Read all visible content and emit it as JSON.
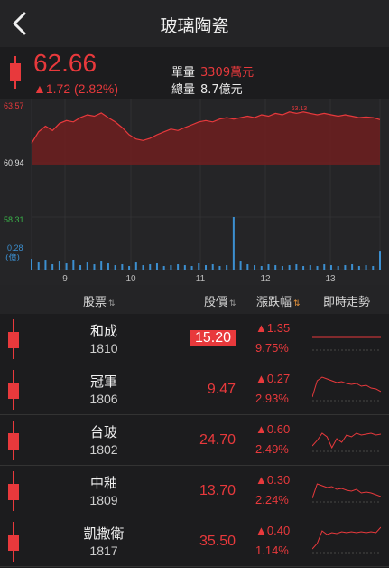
{
  "header": {
    "title": "玻璃陶瓷"
  },
  "quote": {
    "price": "62.66",
    "change": "▲1.72 (2.82%)",
    "single_volume_label": "單量",
    "single_volume_value": "3309萬元",
    "total_volume_label": "總量",
    "total_volume_value": "8.7億元"
  },
  "colors": {
    "up": "#e8393c",
    "down": "#3ab54a",
    "volume": "#3c8fd0",
    "background": "#1c1c1e",
    "sort_active": "#e8943c"
  },
  "chart_data": {
    "type": "area",
    "price_axis": {
      "high_label": "63.57",
      "open_label": "60.94",
      "peak_annotation": "63.13",
      "ylim": [
        59.5,
        63.57
      ]
    },
    "volume_axis": {
      "max_label": "58.31",
      "min_label": "0.28",
      "unit_label": "(億)"
    },
    "x_labels": [
      "9",
      "10",
      "11",
      "12",
      "13"
    ],
    "price_series": [
      61.0,
      61.8,
      62.2,
      61.9,
      62.4,
      62.6,
      62.5,
      62.8,
      63.0,
      62.9,
      63.13,
      62.8,
      62.5,
      62.1,
      61.6,
      61.3,
      61.2,
      61.35,
      61.6,
      61.8,
      62.0,
      61.9,
      62.1,
      62.3,
      62.5,
      62.6,
      62.5,
      62.7,
      62.8,
      62.7,
      62.8,
      62.9,
      62.8,
      63.0,
      62.9,
      63.1,
      63.0,
      63.2,
      63.1,
      63.2,
      63.1,
      63.0,
      63.1,
      63.0,
      62.9,
      63.0,
      62.9,
      62.8,
      62.85,
      62.8,
      62.66
    ],
    "volume_series": [
      12,
      8,
      10,
      6,
      9,
      7,
      11,
      5,
      8,
      6,
      9,
      7,
      5,
      6,
      4,
      8,
      5,
      6,
      7,
      4,
      5,
      6,
      5,
      4,
      7,
      5,
      6,
      4,
      5,
      58.31,
      9,
      6,
      5,
      4,
      6,
      5,
      4,
      5,
      6,
      4,
      5,
      4,
      6,
      5,
      4,
      5,
      6,
      4,
      5,
      4,
      20
    ]
  },
  "table": {
    "headers": {
      "stock": "股票",
      "price": "股價",
      "change": "漲跌幅",
      "trend": "即時走勢"
    },
    "sort_icon": "⇅",
    "rows": [
      {
        "name": "和成",
        "code": "1810",
        "price": "15.20",
        "change": "▲1.35",
        "pct": "9.75%",
        "highlight": true,
        "spark": [
          20,
          20,
          20,
          20,
          20,
          20,
          20,
          20,
          20,
          20,
          20,
          20,
          20,
          20,
          20
        ]
      },
      {
        "name": "冠軍",
        "code": "1806",
        "price": "9.47",
        "change": "▲0.27",
        "pct": "2.93%",
        "highlight": false,
        "spark": [
          30,
          12,
          8,
          10,
          12,
          14,
          13,
          15,
          16,
          15,
          18,
          17,
          20,
          21,
          24
        ]
      },
      {
        "name": "台玻",
        "code": "1802",
        "price": "24.70",
        "change": "▲0.60",
        "pct": "2.49%",
        "highlight": false,
        "spark": [
          28,
          22,
          14,
          18,
          30,
          20,
          24,
          16,
          18,
          14,
          16,
          15,
          14,
          16,
          15
        ]
      },
      {
        "name": "中釉",
        "code": "1809",
        "price": "13.70",
        "change": "▲0.30",
        "pct": "2.24%",
        "highlight": false,
        "spark": [
          30,
          14,
          16,
          18,
          17,
          20,
          19,
          21,
          22,
          20,
          24,
          23,
          24,
          26,
          28
        ]
      },
      {
        "name": "凱撒衛",
        "code": "1817",
        "price": "35.50",
        "change": "▲0.40",
        "pct": "1.14%",
        "highlight": false,
        "spark": [
          30,
          24,
          10,
          14,
          12,
          13,
          11,
          12,
          11,
          12,
          11,
          12,
          11,
          12,
          6
        ]
      }
    ]
  }
}
